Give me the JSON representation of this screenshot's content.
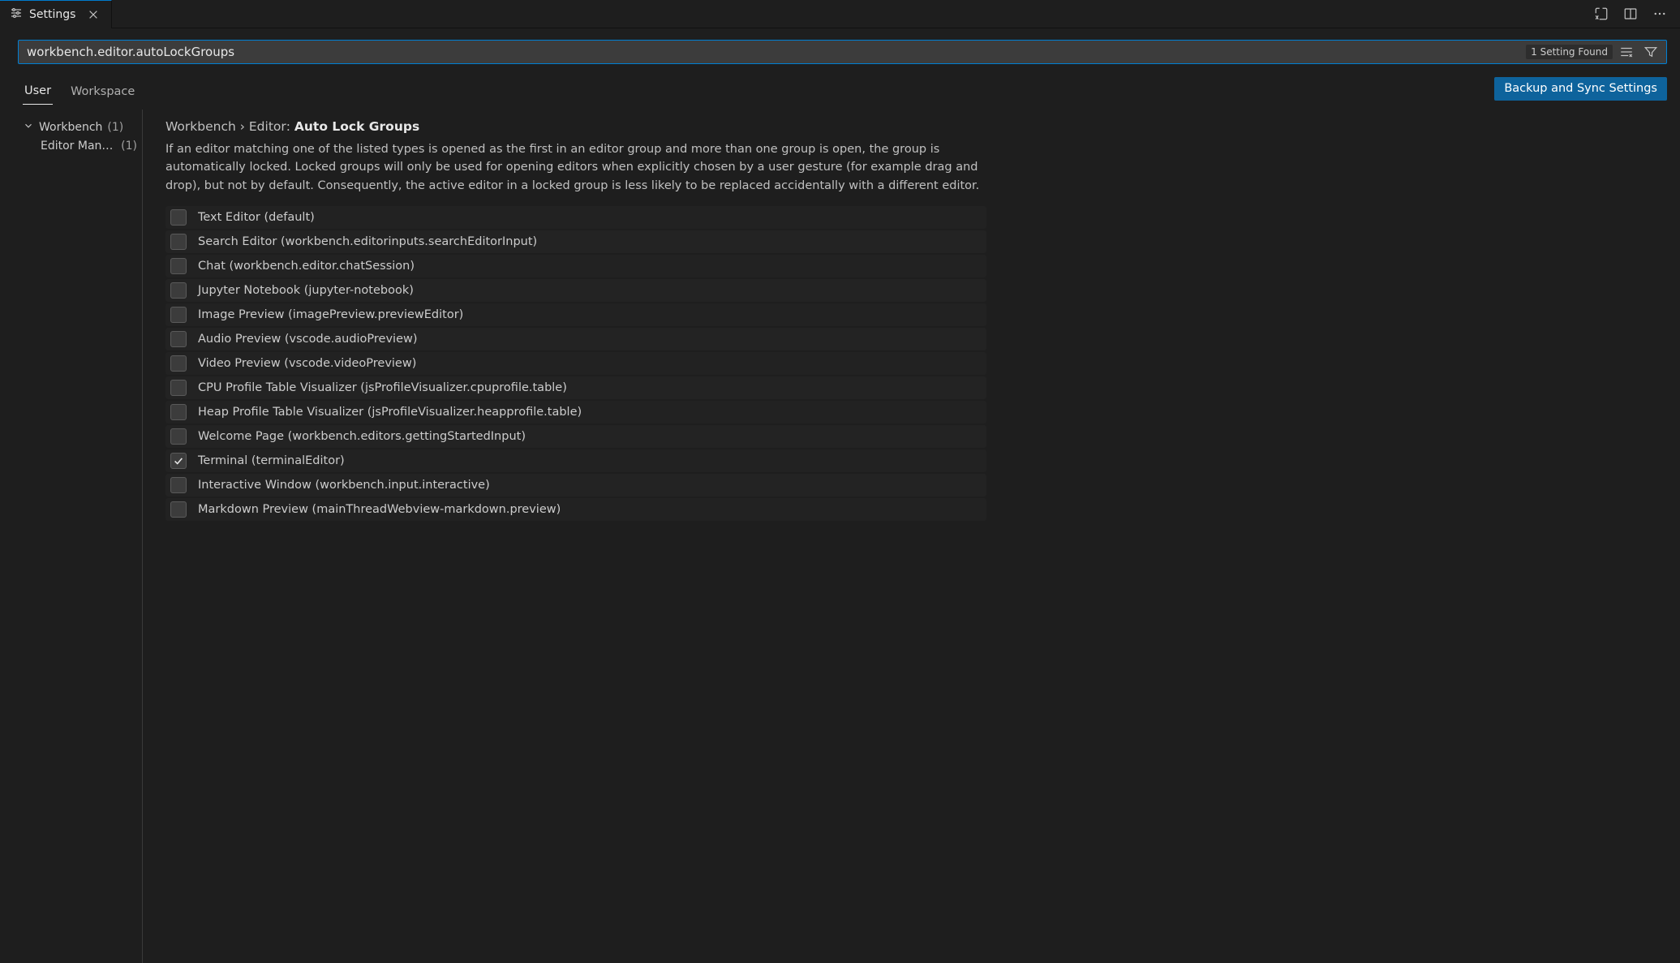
{
  "tab": {
    "title": "Settings"
  },
  "search": {
    "value": "workbench.editor.autoLockGroups",
    "badge": "1 Setting Found"
  },
  "scope": {
    "tabs": [
      "User",
      "Workspace"
    ],
    "active": 0,
    "syncLabel": "Backup and Sync Settings"
  },
  "toc": {
    "root": {
      "label": "Workbench",
      "count": "(1)"
    },
    "child": {
      "label": "Editor Management",
      "count": "(1)"
    }
  },
  "setting": {
    "crumb1": "Workbench",
    "crumb2": "Editor",
    "leaf": "Auto Lock Groups",
    "description": "If an editor matching one of the listed types is opened as the first in an editor group and more than one group is open, the group is automatically locked. Locked groups will only be used for opening editors when explicitly chosen by a user gesture (for example drag and drop), but not by default. Consequently, the active editor in a locked group is less likely to be replaced accidentally with a different editor.",
    "items": [
      {
        "label": "Text Editor (default)",
        "checked": false
      },
      {
        "label": "Search Editor (workbench.editorinputs.searchEditorInput)",
        "checked": false
      },
      {
        "label": "Chat (workbench.editor.chatSession)",
        "checked": false
      },
      {
        "label": "Jupyter Notebook (jupyter-notebook)",
        "checked": false
      },
      {
        "label": "Image Preview (imagePreview.previewEditor)",
        "checked": false
      },
      {
        "label": "Audio Preview (vscode.audioPreview)",
        "checked": false
      },
      {
        "label": "Video Preview (vscode.videoPreview)",
        "checked": false
      },
      {
        "label": "CPU Profile Table Visualizer (jsProfileVisualizer.cpuprofile.table)",
        "checked": false
      },
      {
        "label": "Heap Profile Table Visualizer (jsProfileVisualizer.heapprofile.table)",
        "checked": false
      },
      {
        "label": "Welcome Page (workbench.editors.gettingStartedInput)",
        "checked": false
      },
      {
        "label": "Terminal (terminalEditor)",
        "checked": true
      },
      {
        "label": "Interactive Window (workbench.input.interactive)",
        "checked": false
      },
      {
        "label": "Markdown Preview (mainThreadWebview-markdown.preview)",
        "checked": false
      }
    ]
  }
}
